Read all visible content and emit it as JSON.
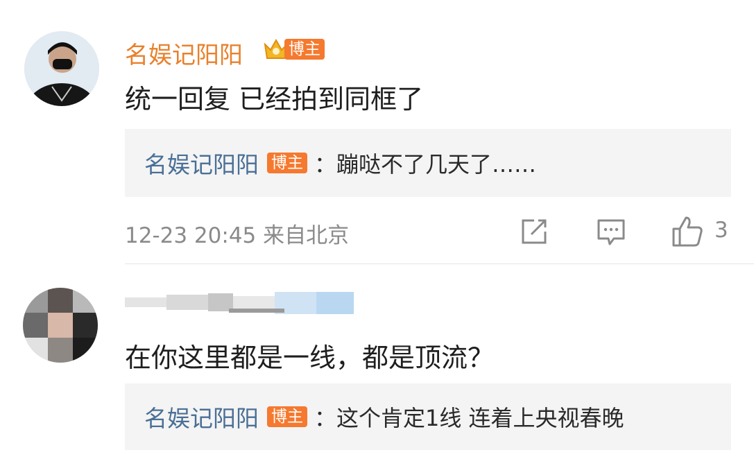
{
  "comments": [
    {
      "username": "名娱记阳阳",
      "badge_label": "博主",
      "text": "统一回复 已经拍到同框了",
      "reply": {
        "username": "名娱记阳阳",
        "badge_label": "博主",
        "text": "：蹦哒不了几天了……"
      },
      "time": "12-23 20:45 来自北京",
      "like_count": "3"
    },
    {
      "text": "在你这里都是一线，都是顶流？",
      "reply": {
        "username": "名娱记阳阳",
        "badge_label": "博主",
        "text": "：这个肯定1线 连着上央视春晚"
      }
    }
  ],
  "icons": {
    "share": "share-icon",
    "comment": "comment-icon",
    "like": "like-icon",
    "crown": "crown-icon"
  },
  "colors": {
    "username": "#e8812c",
    "reply_username": "#4a6f96",
    "badge": "#f5792e",
    "reply_bg": "#f4f4f4",
    "meta": "#8a8a8a"
  }
}
